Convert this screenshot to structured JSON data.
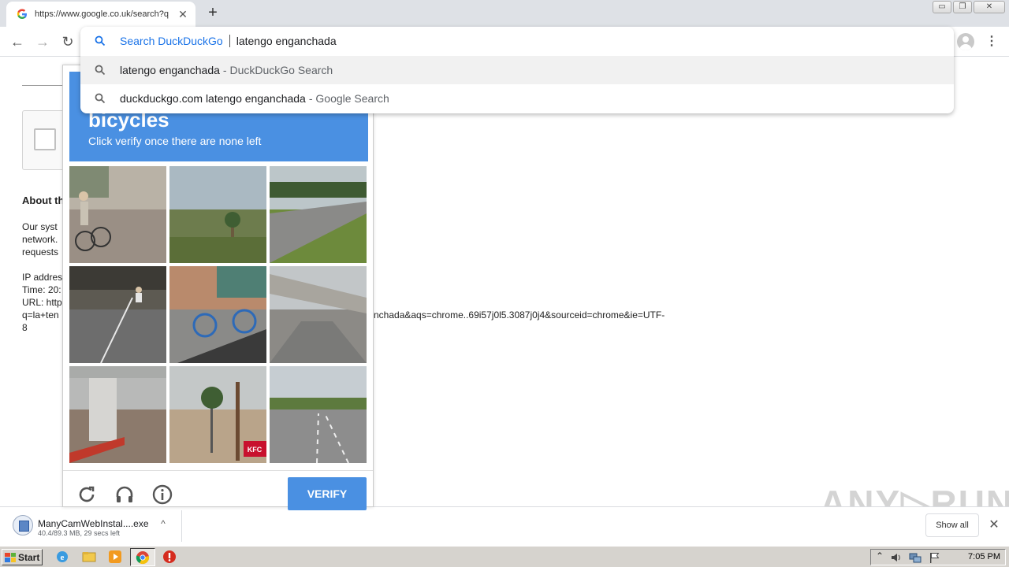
{
  "tab": {
    "title": "https://www.google.co.uk/search?q",
    "close_glyph": "✕",
    "new_tab_glyph": "+"
  },
  "window_controls": {
    "minimize": "▭",
    "restore": "❐",
    "close": "✕"
  },
  "toolbar": {
    "back": "←",
    "forward": "→",
    "reload": "↻",
    "menu": "⋮"
  },
  "omnibox": {
    "keyword": "Search DuckDuckGo",
    "input_value": "latengo enganchada",
    "suggestions": [
      {
        "main": "latengo enganchada",
        "sub": "- DuckDuckGo Search"
      },
      {
        "main": "duckduckgo.com latengo enganchada",
        "sub": "- Google Search"
      }
    ]
  },
  "page": {
    "about_heading": "About th",
    "body_lines": [
      "Our syst",
      "network.",
      "requests"
    ],
    "ip_lines": [
      "IP addres",
      "Time: 20:",
      "URL: http",
      "q=la+ten",
      "8"
    ],
    "url_tail": "nchada&aqs=chrome..69i57j0l5.3087j0j4&sourceid=chrome&ie=UTF-"
  },
  "captcha": {
    "target": "bicycles",
    "instruction": "Click verify once there are none left",
    "verify_label": "VERIFY",
    "tiles": [
      {
        "scene": "street-cyclist",
        "sky": "#b9b2a6",
        "ground": "#9a8f85"
      },
      {
        "scene": "palm-sky",
        "sky": "#aab9c2",
        "ground": "#6d7c4d"
      },
      {
        "scene": "highway-grass",
        "sky": "#bcc6c9",
        "ground": "#6d8a3c"
      },
      {
        "scene": "cyclist-road",
        "sky": "#5d5a52",
        "ground": "#6d6d6d"
      },
      {
        "scene": "parked-bikes",
        "sky": "#b98a6c",
        "ground": "#8a8a88"
      },
      {
        "scene": "overpass",
        "sky": "#c2c6c8",
        "ground": "#8c8a86"
      },
      {
        "scene": "pillar",
        "sky": "#b8b9b8",
        "ground": "#8c7a6c"
      },
      {
        "scene": "palm-kfc",
        "sky": "#c4c8c8",
        "ground": "#b9a48a"
      },
      {
        "scene": "highway",
        "sky": "#c6cdd2",
        "ground": "#8d8d8d"
      }
    ],
    "kfc_text": "KFC"
  },
  "watermark": "ANY▷RUN",
  "download": {
    "filename": "ManyCamWebInstal....exe",
    "status": "40.4/89.3 MB, 29 secs left",
    "chevron": "^",
    "show_all": "Show all",
    "close_glyph": "✕"
  },
  "taskbar": {
    "start_label": "Start",
    "clock": "7:05 PM",
    "tray_arrow": "⌃"
  },
  "colors": {
    "recaptcha_blue": "#4a90e2",
    "omnibox_keyword": "#1a73e8"
  }
}
